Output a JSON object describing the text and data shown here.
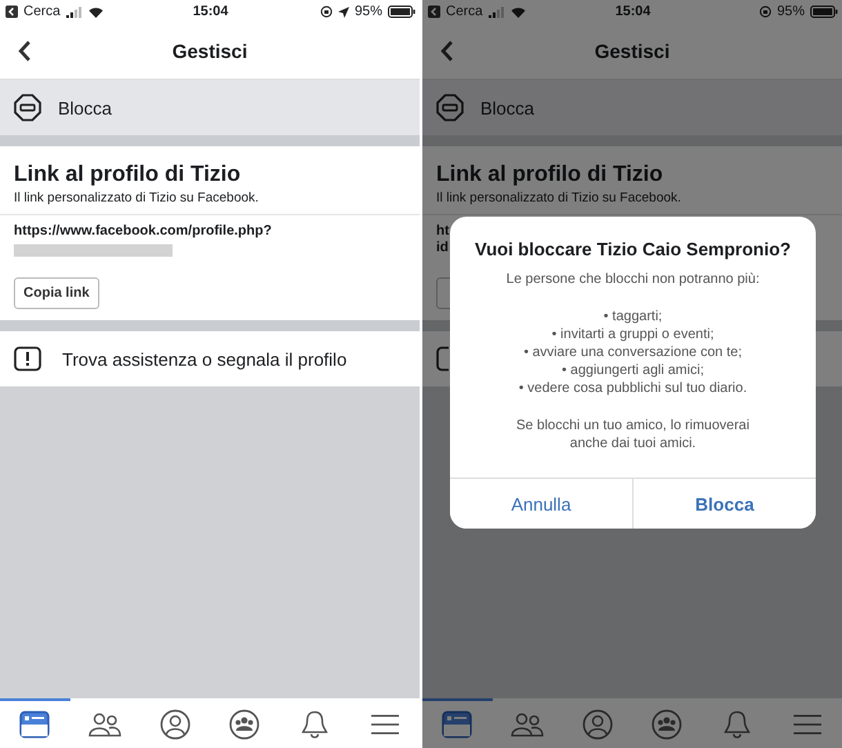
{
  "screens": [
    {
      "status_bar": {
        "back_app": "Cerca",
        "time": "15:04",
        "location_on": true,
        "battery": "95%"
      },
      "nav": {
        "title": "Gestisci"
      },
      "block_row": {
        "label": "Blocca"
      },
      "link_card": {
        "title": "Link al profilo di Tizio",
        "subtitle": "Il link personalizzato di Tizio su Facebook.",
        "url_lines": [
          "https://www.facebook.com/profile.php?"
        ],
        "redacted": true,
        "copy_button": {
          "label": "Copia link"
        }
      },
      "help_row": {
        "label": "Trova assistenza o segnala il profilo"
      },
      "tab_bar": [
        {
          "kind": "feed",
          "selected": true
        },
        {
          "kind": "friends",
          "selected": false
        },
        {
          "kind": "profile",
          "selected": false
        },
        {
          "kind": "groups",
          "selected": false
        },
        {
          "kind": "notifications",
          "selected": false
        },
        {
          "kind": "menu",
          "selected": false
        }
      ]
    },
    {
      "status_bar": {
        "back_app": "Cerca",
        "time": "15:04",
        "battery": "95%"
      },
      "nav": {
        "title": "Gestisci"
      },
      "block_row": {
        "label": "Blocca"
      },
      "link_card": {
        "title": "Link al profilo di Tizio",
        "subtitle": "Il link personalizzato di Tizio su Facebook.",
        "url_lines": [
          "ht",
          "id"
        ]
      },
      "tab_bar": [
        {
          "kind": "feed",
          "selected": true
        },
        {
          "kind": "friends",
          "selected": false
        },
        {
          "kind": "profile",
          "selected": false
        },
        {
          "kind": "groups",
          "selected": false
        },
        {
          "kind": "notifications",
          "selected": false
        },
        {
          "kind": "menu",
          "selected": false
        }
      ],
      "dialog": {
        "title": "Vuoi bloccare Tizio Caio Sempronio?",
        "intro": "Le persone che blocchi non potranno più:",
        "bullets": [
          "• taggarti;",
          "• invitarti a gruppi o eventi;",
          "• avviare una conversazione con te;",
          "• aggiungerti agli amici;",
          "• vedere cosa pubblichi sul tuo diario."
        ],
        "note": "Se blocchi un tuo amico, lo rimuoverai anche dai tuoi amici.",
        "buttons": [
          {
            "label": "Annulla",
            "kind": "cancel"
          },
          {
            "label": "Blocca",
            "kind": "preferred"
          }
        ]
      }
    }
  ]
}
